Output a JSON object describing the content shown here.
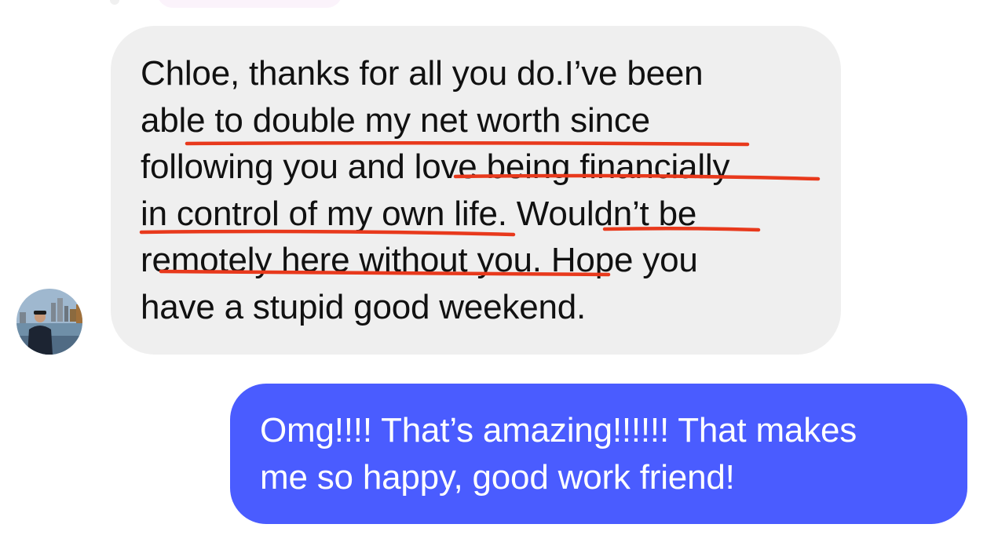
{
  "conversation": {
    "incoming": {
      "lines": [
        "Chloe, thanks for all you do.I’ve been",
        "able to double my net worth since",
        "following you and love being financially",
        "in control of my own life. Wouldn’t be",
        "remotely here without you. Hope you",
        "have a stupid good weekend."
      ],
      "bubble_color": "#efefef",
      "underline_color": "#e8391c"
    },
    "outgoing": {
      "lines": [
        "Omg!!!! That’s amazing!!!!!! That makes",
        "me so happy, good work friend!"
      ],
      "bubble_color": "#4a5cff"
    }
  }
}
